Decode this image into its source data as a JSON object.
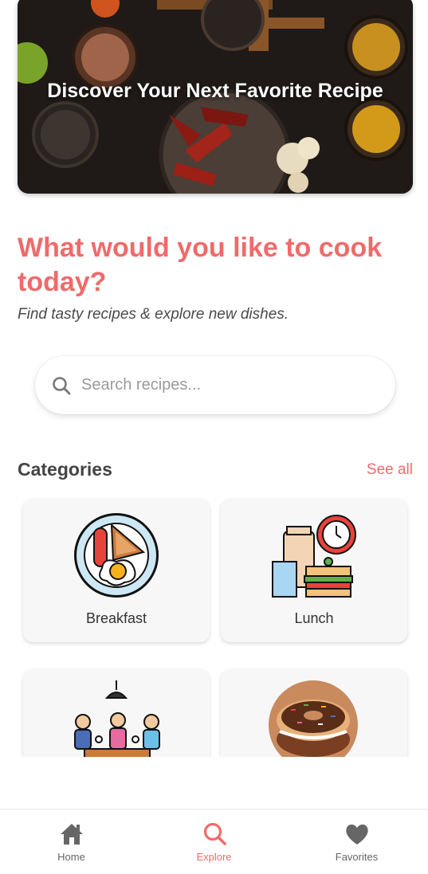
{
  "hero": {
    "title": "Discover Your Next Favorite Recipe"
  },
  "headline": "What would you like to cook today?",
  "subheadline": "Find tasty recipes & explore new dishes.",
  "search": {
    "placeholder": "Search recipes..."
  },
  "categories": {
    "title": "Categories",
    "see_all": "See all",
    "items": [
      {
        "label": "Breakfast",
        "icon": "breakfast-plate-icon"
      },
      {
        "label": "Lunch",
        "icon": "lunch-clock-icon"
      },
      {
        "label": "",
        "icon": "dinner-table-icon"
      },
      {
        "label": "",
        "icon": "donut-dessert-icon"
      }
    ]
  },
  "bottom_nav": {
    "items": [
      {
        "label": "Home",
        "icon": "home-icon",
        "active": false
      },
      {
        "label": "Explore",
        "icon": "search-icon",
        "active": true
      },
      {
        "label": "Favorites",
        "icon": "heart-icon",
        "active": false
      }
    ]
  },
  "colors": {
    "accent": "#ef6b6b",
    "nav_inactive": "#666666"
  }
}
